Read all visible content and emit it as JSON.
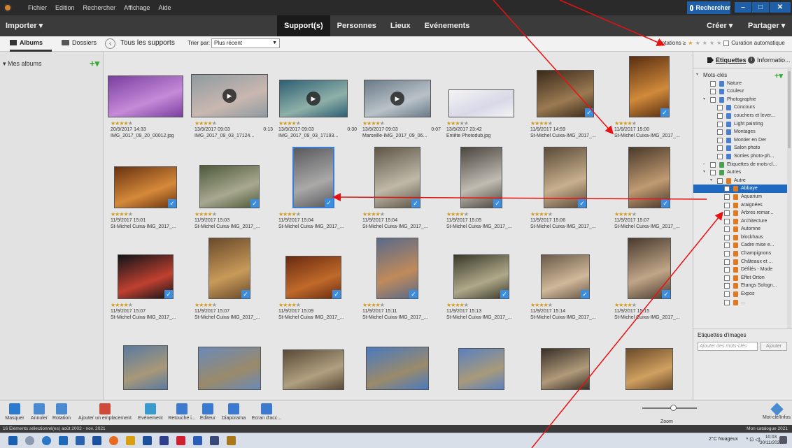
{
  "menu": [
    "Fichier",
    "Edition",
    "Rechercher",
    "Affichage",
    "Aide"
  ],
  "search_button": "Rechercher",
  "window_controls": [
    "–",
    "□",
    "✕"
  ],
  "toolbar": {
    "import": "Importer ▾",
    "tabs": [
      "Support(s)",
      "Personnes",
      "Lieux",
      "Evénements"
    ],
    "create": "Créer ▾",
    "share": "Partager ▾"
  },
  "subbar": {
    "albums_tab": "Albums",
    "folders_tab": "Dossiers",
    "back": "‹",
    "all_media": "Tous les supports",
    "sort_label": "Trier par:",
    "sort_value": "Plus récent",
    "rating_label": "Notations ≥",
    "rating_value": 1,
    "auto_curation": "Curation automatique"
  },
  "left_panel": {
    "section": "▾ Mes albums",
    "add": "+▾"
  },
  "photos": [
    {
      "rating": 4,
      "date": "20/9/2017 14:33",
      "name": "IMG_2017_09_20_00012.jpg",
      "duration": "",
      "video": false,
      "checked": false,
      "selected": false,
      "c1": "#7a3fa0",
      "c2": "#c58ad8"
    },
    {
      "rating": 4,
      "date": "13/9/2017 09:03",
      "name": "IMG_2017_09_03_17124...",
      "duration": "0:13",
      "video": true,
      "checked": false,
      "selected": false,
      "c1": "#8e9aa0",
      "c2": "#c9b7b0"
    },
    {
      "rating": 4,
      "date": "13/9/2017 09:03",
      "name": "IMG_2017_09_03_17193...",
      "duration": "0:30",
      "video": true,
      "checked": false,
      "selected": false,
      "c1": "#2d5f73",
      "c2": "#8fb0a8"
    },
    {
      "rating": 4,
      "date": "13/9/2017 09:03",
      "name": "Marseille-IMG_2017_09_06...",
      "duration": "0:07",
      "video": true,
      "checked": false,
      "selected": false,
      "c1": "#6a7a88",
      "c2": "#b9c2c8"
    },
    {
      "rating": 3,
      "date": "13/9/2017 23:42",
      "name": "Entête Photodub.jpg",
      "duration": "",
      "video": false,
      "checked": false,
      "selected": false,
      "c1": "#f4f4f4",
      "c2": "#d8d8e8"
    },
    {
      "rating": 4,
      "date": "11/9/2017 14:59",
      "name": "St-Michel Cuixa-IMG_2017_...",
      "duration": "",
      "video": false,
      "checked": true,
      "selected": false,
      "c1": "#3a2a1a",
      "c2": "#9a7a52"
    },
    {
      "rating": 4,
      "date": "11/9/2017 15:00",
      "name": "St-Michel Cuixa-IMG_2017_...",
      "duration": "",
      "video": false,
      "checked": true,
      "selected": false,
      "c1": "#5a2e12",
      "c2": "#d08a3a"
    },
    {
      "rating": 4,
      "date": "11/9/2017 15:01",
      "name": "St-Michel Cuixa-IMG_2017_...",
      "duration": "",
      "video": false,
      "checked": true,
      "selected": false,
      "c1": "#6a3210",
      "c2": "#d58a3a"
    },
    {
      "rating": 4,
      "date": "11/9/2017 15:03",
      "name": "St-Michel Cuixa-IMG_2017_...",
      "duration": "",
      "video": false,
      "checked": true,
      "selected": false,
      "c1": "#4e5a3a",
      "c2": "#a8a890"
    },
    {
      "rating": 4,
      "date": "11/9/2017 15:04",
      "name": "St-Michel Cuixa-IMG_2017_...",
      "duration": "",
      "video": false,
      "checked": true,
      "selected": true,
      "c1": "#5a5a5e",
      "c2": "#aaa9a8"
    },
    {
      "rating": 4,
      "date": "11/9/2017 15:04",
      "name": "St-Michel Cuixa-IMG_2017_...",
      "duration": "",
      "video": false,
      "checked": true,
      "selected": false,
      "c1": "#5f5648",
      "c2": "#bfb9a8"
    },
    {
      "rating": 4,
      "date": "11/9/2017 15:05",
      "name": "St-Michel Cuixa-IMG_2017_...",
      "duration": "",
      "video": false,
      "checked": true,
      "selected": false,
      "c1": "#4a4640",
      "c2": "#c0bcb2"
    },
    {
      "rating": 4,
      "date": "11/9/2017 15:06",
      "name": "St-Michel Cuixa-IMG_2017_...",
      "duration": "",
      "video": false,
      "checked": true,
      "selected": false,
      "c1": "#5a4a38",
      "c2": "#c8b08e"
    },
    {
      "rating": 4,
      "date": "11/9/2017 15:07",
      "name": "St-Michel Cuixa-IMG_2017_...",
      "duration": "",
      "video": false,
      "checked": true,
      "selected": false,
      "c1": "#4a3a2a",
      "c2": "#c09a72"
    },
    {
      "rating": 4,
      "date": "11/9/2017 15:07",
      "name": "St-Michel Cuixa-IMG_2017_...",
      "duration": "",
      "video": false,
      "checked": true,
      "selected": false,
      "c1": "#101418",
      "c2": "#c04030"
    },
    {
      "rating": 4,
      "date": "11/9/2017 15:07",
      "name": "St-Michel Cuixa-IMG_2017_...",
      "duration": "",
      "video": false,
      "checked": true,
      "selected": false,
      "c1": "#6a4a2a",
      "c2": "#c89a5a"
    },
    {
      "rating": 4,
      "date": "11/9/2017 15:09",
      "name": "St-Michel Cuixa-IMG_2017_...",
      "duration": "",
      "video": false,
      "checked": true,
      "selected": false,
      "c1": "#6a2a10",
      "c2": "#c06a2a"
    },
    {
      "rating": 4,
      "date": "11/9/2017 15:11",
      "name": "St-Michel Cuixa-IMG_2017_...",
      "duration": "",
      "video": false,
      "checked": true,
      "selected": false,
      "c1": "#5a6a8a",
      "c2": "#c08a5a"
    },
    {
      "rating": 4,
      "date": "11/9/2017 15:13",
      "name": "St-Michel Cuixa-IMG_2017_...",
      "duration": "",
      "video": false,
      "checked": true,
      "selected": false,
      "c1": "#3a3a2a",
      "c2": "#b0a88a"
    },
    {
      "rating": 4,
      "date": "11/9/2017 15:14",
      "name": "St-Michel Cuixa-IMG_2017_...",
      "duration": "",
      "video": false,
      "checked": true,
      "selected": false,
      "c1": "#6a5a48",
      "c2": "#d0b89a"
    },
    {
      "rating": 4,
      "date": "11/9/2017 15:15",
      "name": "St-Michel Cuixa-IMG_2017_...",
      "duration": "",
      "video": false,
      "checked": true,
      "selected": false,
      "c1": "#4a3a2e",
      "c2": "#c0a688"
    },
    {
      "rating": 0,
      "date": "",
      "name": "",
      "duration": "",
      "video": false,
      "checked": false,
      "selected": false,
      "c1": "#5a7aa0",
      "c2": "#a89878"
    },
    {
      "rating": 0,
      "date": "",
      "name": "",
      "duration": "",
      "video": false,
      "checked": false,
      "selected": false,
      "c1": "#6a8ab8",
      "c2": "#9a8a6a"
    },
    {
      "rating": 0,
      "date": "",
      "name": "",
      "duration": "",
      "video": false,
      "checked": false,
      "selected": false,
      "c1": "#5a4a38",
      "c2": "#b0a080"
    },
    {
      "rating": 0,
      "date": "",
      "name": "",
      "duration": "",
      "video": false,
      "checked": false,
      "selected": false,
      "c1": "#4a7ac0",
      "c2": "#9a8a6a"
    },
    {
      "rating": 0,
      "date": "",
      "name": "",
      "duration": "",
      "video": false,
      "checked": false,
      "selected": false,
      "c1": "#5a80c0",
      "c2": "#a89a7a"
    },
    {
      "rating": 0,
      "date": "",
      "name": "",
      "duration": "",
      "video": false,
      "checked": false,
      "selected": false,
      "c1": "#3a3028",
      "c2": "#b09a7a"
    },
    {
      "rating": 0,
      "date": "",
      "name": "",
      "duration": "",
      "video": false,
      "checked": false,
      "selected": false,
      "c1": "#6a4a2a",
      "c2": "#d0a060"
    }
  ],
  "right_panel": {
    "tab_tags": "Etiquettes",
    "tab_info": "Informatio...",
    "add": "+▾",
    "tags": [
      {
        "label": "Mots-clés",
        "level": 0,
        "toggle": "▾",
        "check": false,
        "icon": "",
        "selected": false
      },
      {
        "label": "Nature",
        "level": 1,
        "toggle": "",
        "check": true,
        "icon": "#4a7fd0",
        "selected": false
      },
      {
        "label": "Couleur",
        "level": 1,
        "toggle": "",
        "check": true,
        "icon": "#4a7fd0",
        "selected": false
      },
      {
        "label": "Photographie",
        "level": 1,
        "toggle": "▾",
        "check": true,
        "icon": "#4a7fd0",
        "selected": false
      },
      {
        "label": "Concours",
        "level": 2,
        "toggle": "",
        "check": true,
        "icon": "#4a7fd0",
        "selected": false
      },
      {
        "label": "couchers et lever...",
        "level": 2,
        "toggle": "",
        "check": true,
        "icon": "#4a7fd0",
        "selected": false
      },
      {
        "label": "Light painting",
        "level": 2,
        "toggle": "",
        "check": true,
        "icon": "#4a7fd0",
        "selected": false
      },
      {
        "label": "Montages",
        "level": 2,
        "toggle": "",
        "check": true,
        "icon": "#4a7fd0",
        "selected": false
      },
      {
        "label": "Montier en Der",
        "level": 2,
        "toggle": "",
        "check": true,
        "icon": "#4a7fd0",
        "selected": false
      },
      {
        "label": "Salon photo",
        "level": 2,
        "toggle": "",
        "check": true,
        "icon": "#4a7fd0",
        "selected": false
      },
      {
        "label": "Sorties photo-ph...",
        "level": 2,
        "toggle": "",
        "check": true,
        "icon": "#4a7fd0",
        "selected": false
      },
      {
        "label": "Etiquettes de mots-cl...",
        "level": 1,
        "toggle": "›",
        "check": true,
        "icon": "#4aa050",
        "selected": false
      },
      {
        "label": "Autres",
        "level": 1,
        "toggle": "▾",
        "check": true,
        "icon": "#4aa050",
        "selected": false
      },
      {
        "label": "Autre",
        "level": 2,
        "toggle": "▾",
        "check": true,
        "icon": "#e07a20",
        "selected": false
      },
      {
        "label": "Abbaye",
        "level": 3,
        "toggle": "",
        "check": true,
        "icon": "#e07a20",
        "selected": true
      },
      {
        "label": "Aquarium",
        "level": 3,
        "toggle": "",
        "check": true,
        "icon": "#e07a20",
        "selected": false
      },
      {
        "label": "araignées",
        "level": 3,
        "toggle": "",
        "check": true,
        "icon": "#e07a20",
        "selected": false
      },
      {
        "label": "Arbres remar...",
        "level": 3,
        "toggle": "",
        "check": true,
        "icon": "#e07a20",
        "selected": false
      },
      {
        "label": "Architecture",
        "level": 3,
        "toggle": "",
        "check": true,
        "icon": "#e07a20",
        "selected": false
      },
      {
        "label": "Automne",
        "level": 3,
        "toggle": "",
        "check": true,
        "icon": "#e07a20",
        "selected": false
      },
      {
        "label": "blockhaus",
        "level": 3,
        "toggle": "",
        "check": true,
        "icon": "#e07a20",
        "selected": false
      },
      {
        "label": "Cadre mise e...",
        "level": 3,
        "toggle": "",
        "check": true,
        "icon": "#e07a20",
        "selected": false
      },
      {
        "label": "Champignons",
        "level": 3,
        "toggle": "",
        "check": true,
        "icon": "#e07a20",
        "selected": false
      },
      {
        "label": "Châteaux et ...",
        "level": 3,
        "toggle": "",
        "check": true,
        "icon": "#e07a20",
        "selected": false
      },
      {
        "label": "Défilés - Mode",
        "level": 3,
        "toggle": "",
        "check": true,
        "icon": "#e07a20",
        "selected": false
      },
      {
        "label": "Effet Orton",
        "level": 3,
        "toggle": "",
        "check": true,
        "icon": "#e07a20",
        "selected": false
      },
      {
        "label": "Etangs Sologn...",
        "level": 3,
        "toggle": "",
        "check": true,
        "icon": "#e07a20",
        "selected": false
      },
      {
        "label": "Expos",
        "level": 3,
        "toggle": "",
        "check": true,
        "icon": "#e07a20",
        "selected": false
      },
      {
        "label": "...",
        "level": 3,
        "toggle": "",
        "check": true,
        "icon": "#e07a20",
        "selected": false
      }
    ],
    "image_tags_title": "Etiquettes d'images",
    "image_tags_placeholder": "Ajouter des mots-clés",
    "image_tags_button": "Ajouter"
  },
  "bottom": {
    "items": [
      {
        "label": "Masquer",
        "icon": "hide-icon",
        "color": "#2a7ad0"
      },
      {
        "label": "Annuler",
        "icon": "undo-icon",
        "color": "#4a8ad0"
      },
      {
        "label": "Rotation",
        "icon": "rotate-icon",
        "color": "#4a8ad0"
      },
      {
        "label": "Ajouter un emplacement",
        "icon": "location-pin-icon",
        "color": "#d04a3a"
      },
      {
        "label": "Evénement",
        "icon": "calendar-icon",
        "color": "#3a9ad0"
      },
      {
        "label": "Retouche i...",
        "icon": "instant-fix-icon",
        "color": "#3a7ad0"
      },
      {
        "label": "Editeur",
        "icon": "editor-icon",
        "color": "#3a7ad0"
      },
      {
        "label": "Diaporama",
        "icon": "slideshow-icon",
        "color": "#3a7ad0"
      },
      {
        "label": "Ecran d'acc...",
        "icon": "home-icon",
        "color": "#3a7ad0"
      }
    ],
    "zoom_label": "Zoom",
    "keyword_info_label": "Mot-clé/Infos"
  },
  "status": {
    "left": "16 Eléments sélectionné(es)   août 2002 - nov. 2021",
    "right": "Mon catalogue 2021"
  },
  "taskbar": {
    "weather": "2°C Nuageux",
    "time": "10:03",
    "date": "30/11/2021"
  }
}
